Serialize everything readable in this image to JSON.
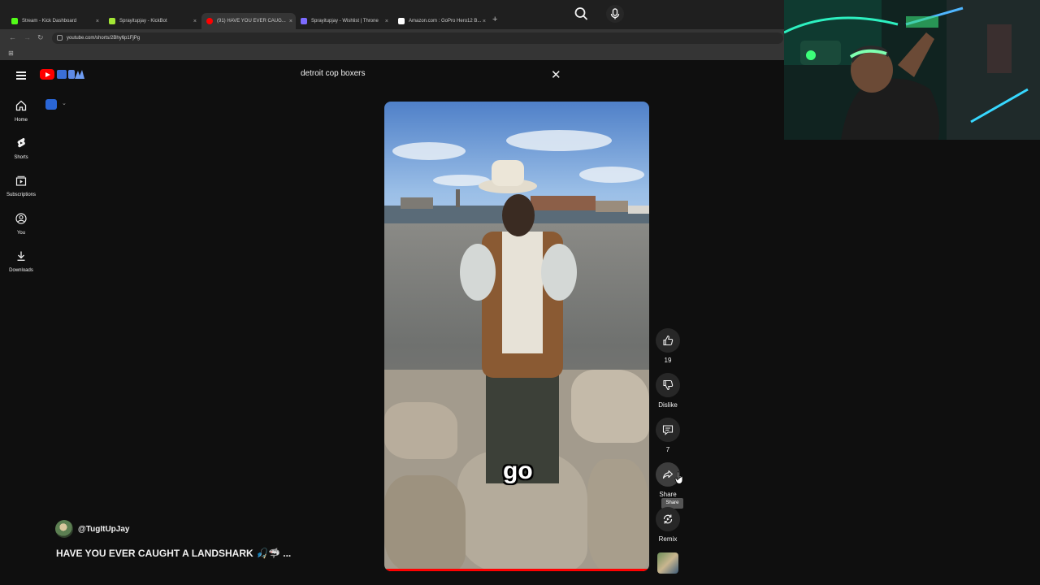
{
  "browser": {
    "tabs": [
      {
        "title": "Stream - Kick Dashboard",
        "favicon_color": "#53fc18",
        "active": false
      },
      {
        "title": "Sprayitupjay - KickBot",
        "favicon_color": "#a3e635",
        "active": false
      },
      {
        "title": "(91) HAVE YOU EVER CAUG...",
        "favicon_color": "#ff0000",
        "active": true
      },
      {
        "title": "Sprayitupjay - Wishlist | Throne",
        "favicon_color": "#7c6bff",
        "active": false
      },
      {
        "title": "Amazon.com : GoPro Hero12 B...",
        "favicon_color": "#ffffff",
        "active": false
      }
    ],
    "close_glyph": "×",
    "new_tab_glyph": "+",
    "url": "youtube.com/shorts/2Bhy6p1FjPg"
  },
  "header": {
    "search_value": "detroit cop boxers",
    "clear_glyph": "✕"
  },
  "sidebar": {
    "items": [
      {
        "label": "Home",
        "icon": "home-icon"
      },
      {
        "label": "Shorts",
        "icon": "shorts-icon"
      },
      {
        "label": "Subscriptions",
        "icon": "subscriptions-icon"
      },
      {
        "label": "You",
        "icon": "user-icon"
      },
      {
        "label": "Downloads",
        "icon": "download-icon"
      }
    ]
  },
  "video": {
    "caption": "go",
    "progress": 1.0,
    "channel": "@TugItUpJay",
    "title": "HAVE YOU EVER CAUGHT A LANDSHARK 🎣🦈 ..."
  },
  "actions": {
    "like_count": "19",
    "dislike_label": "Dislike",
    "comment_count": "7",
    "share_label": "Share",
    "share_tooltip": "Share",
    "remix_label": "Remix"
  },
  "colors": {
    "background": "#0f0f0f",
    "youtube_red": "#ff0000",
    "action_button": "#272727"
  }
}
